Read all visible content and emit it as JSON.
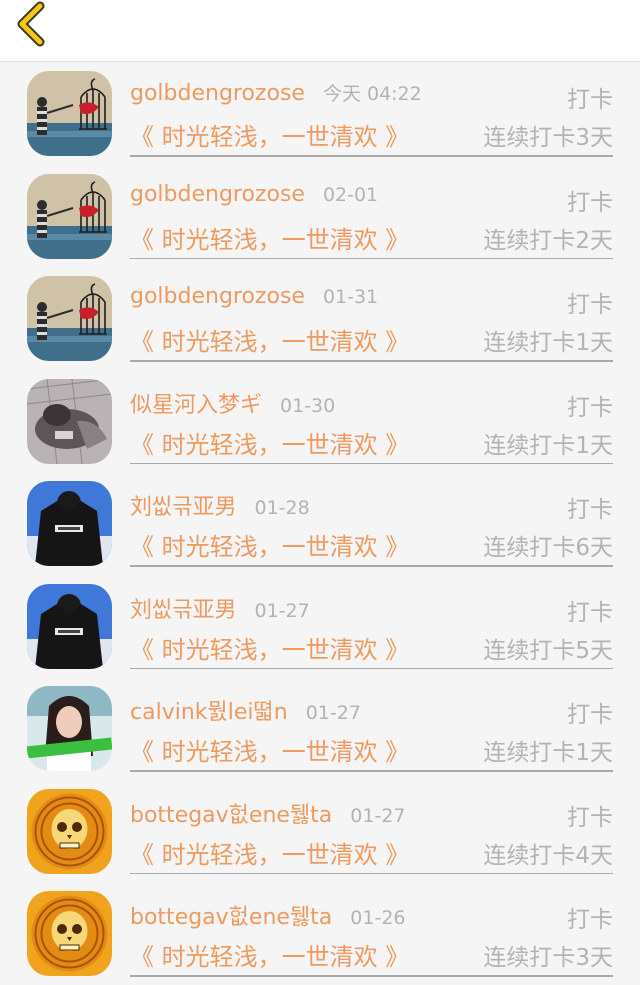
{
  "header": {
    "back_icon": "chevron-left-icon",
    "back_icon_color": "#f5c518"
  },
  "colors": {
    "accent": "#ef9a5f",
    "muted": "#b3b3b3"
  },
  "rows": [
    {
      "name": "golbdengrozose",
      "date": "今天 04:22",
      "kind": "打卡",
      "title": "《 时光轻浅，一世清欢 》",
      "streak": "连续打卡3天",
      "avatar": "birdcage-avatar"
    },
    {
      "name": "golbdengrozose",
      "date": "02-01",
      "kind": "打卡",
      "title": "《 时光轻浅，一世清欢 》",
      "streak": "连续打卡2天",
      "avatar": "birdcage-avatar"
    },
    {
      "name": "golbdengrozose",
      "date": "01-31",
      "kind": "打卡",
      "title": "《 时光轻浅，一世清欢 》",
      "streak": "连续打卡1天",
      "avatar": "birdcage-avatar"
    },
    {
      "name": "似星河入梦ギ",
      "date": "01-30",
      "kind": "打卡",
      "title": "《 时光轻浅，一世清欢 》",
      "streak": "连续打卡1天",
      "avatar": "gray-photo-avatar"
    },
    {
      "name": "刘씺귺亚男",
      "date": "01-28",
      "kind": "打卡",
      "title": "《 时光轻浅，一世清欢 》",
      "streak": "连续打卡6天",
      "avatar": "hoodie-person-avatar"
    },
    {
      "name": "刘씺귺亚男",
      "date": "01-27",
      "kind": "打卡",
      "title": "《 时光轻浅，一世清欢 》",
      "streak": "连续打卡5天",
      "avatar": "hoodie-person-avatar"
    },
    {
      "name": "calvink뭜lei뗣n",
      "date": "01-27",
      "kind": "打卡",
      "title": "《 时光轻浅，一世清欢 》",
      "streak": "连续打卡1天",
      "avatar": "girl-photo-avatar"
    },
    {
      "name": "bottegav헚ene뒗ta",
      "date": "01-27",
      "kind": "打卡",
      "title": "《 时光轻浅，一世清欢 》",
      "streak": "连续打卡4天",
      "avatar": "golden-skull-avatar"
    },
    {
      "name": "bottegav헚ene뒗ta",
      "date": "01-26",
      "kind": "打卡",
      "title": "《 时光轻浅，一世清欢 》",
      "streak": "连续打卡3天",
      "avatar": "golden-skull-avatar"
    }
  ]
}
